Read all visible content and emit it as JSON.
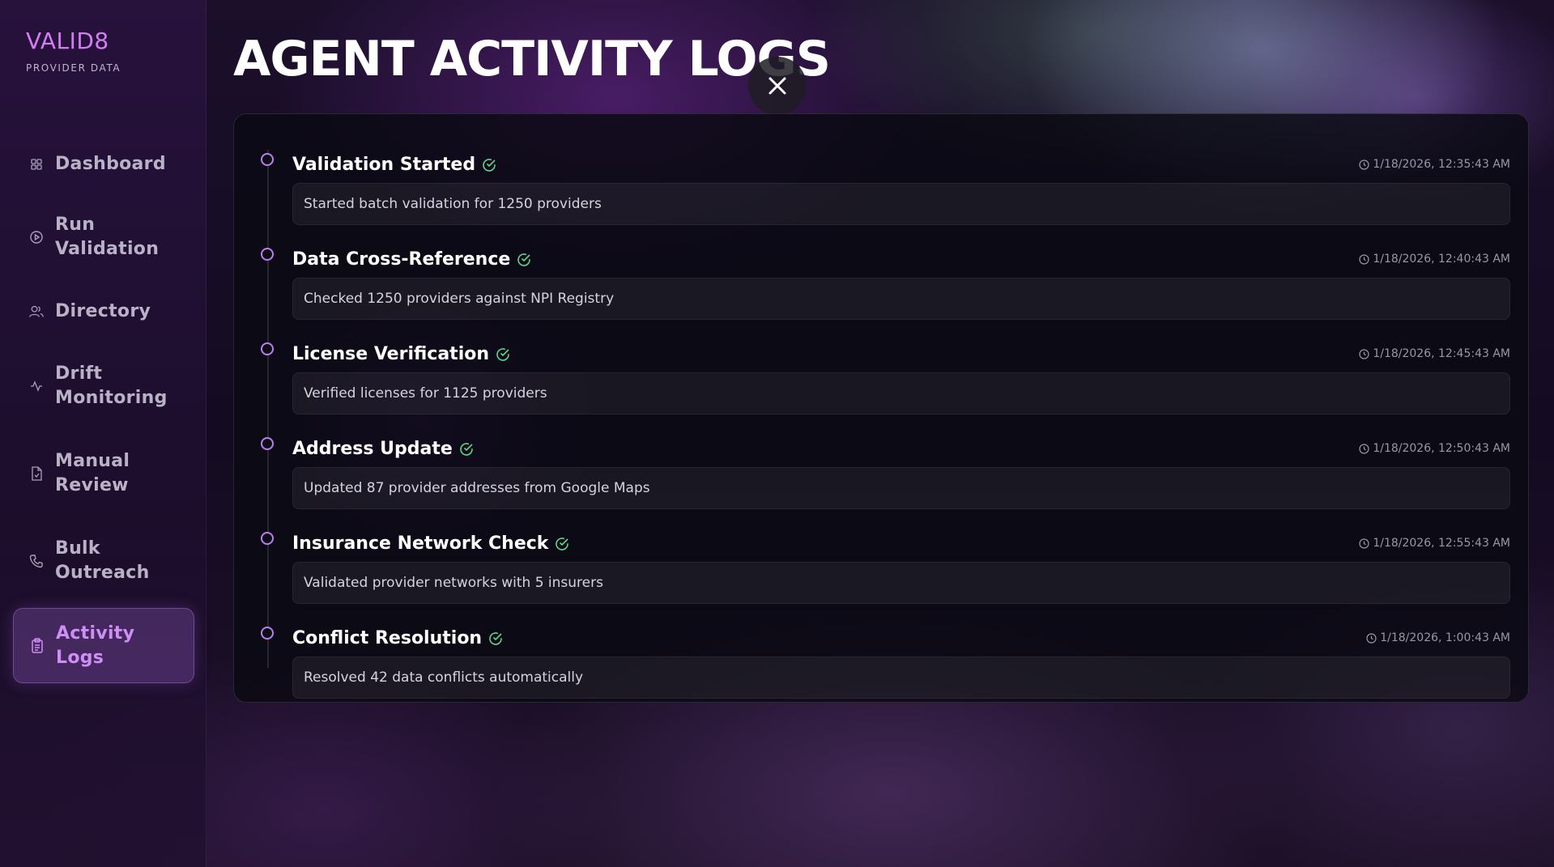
{
  "brand": {
    "name": "VALID8",
    "subtitle": "PROVIDER DATA"
  },
  "sidebar": {
    "items": [
      {
        "label": "Dashboard",
        "icon": "grid-icon",
        "active": false
      },
      {
        "label": "Run Validation",
        "icon": "play-circle-icon",
        "active": false
      },
      {
        "label": "Directory",
        "icon": "users-icon",
        "active": false
      },
      {
        "label": "Drift Monitoring",
        "icon": "activity-icon",
        "active": false
      },
      {
        "label": "Manual Review",
        "icon": "file-icon",
        "active": false
      },
      {
        "label": "Bulk Outreach",
        "icon": "phone-icon",
        "active": false
      },
      {
        "label": "Activity Logs",
        "icon": "clipboard-icon",
        "active": true
      }
    ]
  },
  "page": {
    "title": "AGENT ACTIVITY LOGS",
    "close_icon": "close-icon"
  },
  "logs": [
    {
      "title": "Validation Started",
      "time": "1/18/2026, 12:35:43 AM",
      "description": "Started batch validation for 1250 providers",
      "status": "success"
    },
    {
      "title": "Data Cross-Reference",
      "time": "1/18/2026, 12:40:43 AM",
      "description": "Checked 1250 providers against NPI Registry",
      "status": "success"
    },
    {
      "title": "License Verification",
      "time": "1/18/2026, 12:45:43 AM",
      "description": "Verified licenses for 1125 providers",
      "status": "success"
    },
    {
      "title": "Address Update",
      "time": "1/18/2026, 12:50:43 AM",
      "description": "Updated 87 provider addresses from Google Maps",
      "status": "success"
    },
    {
      "title": "Insurance Network Check",
      "time": "1/18/2026, 12:55:43 AM",
      "description": "Validated provider networks with 5 insurers",
      "status": "success"
    },
    {
      "title": "Conflict Resolution",
      "time": "1/18/2026, 1:00:43 AM",
      "description": "Resolved 42 data conflicts automatically",
      "status": "success"
    }
  ],
  "colors": {
    "accent": "#cf8ef4",
    "success": "#5fd68a",
    "dot": "#b97ef0"
  }
}
